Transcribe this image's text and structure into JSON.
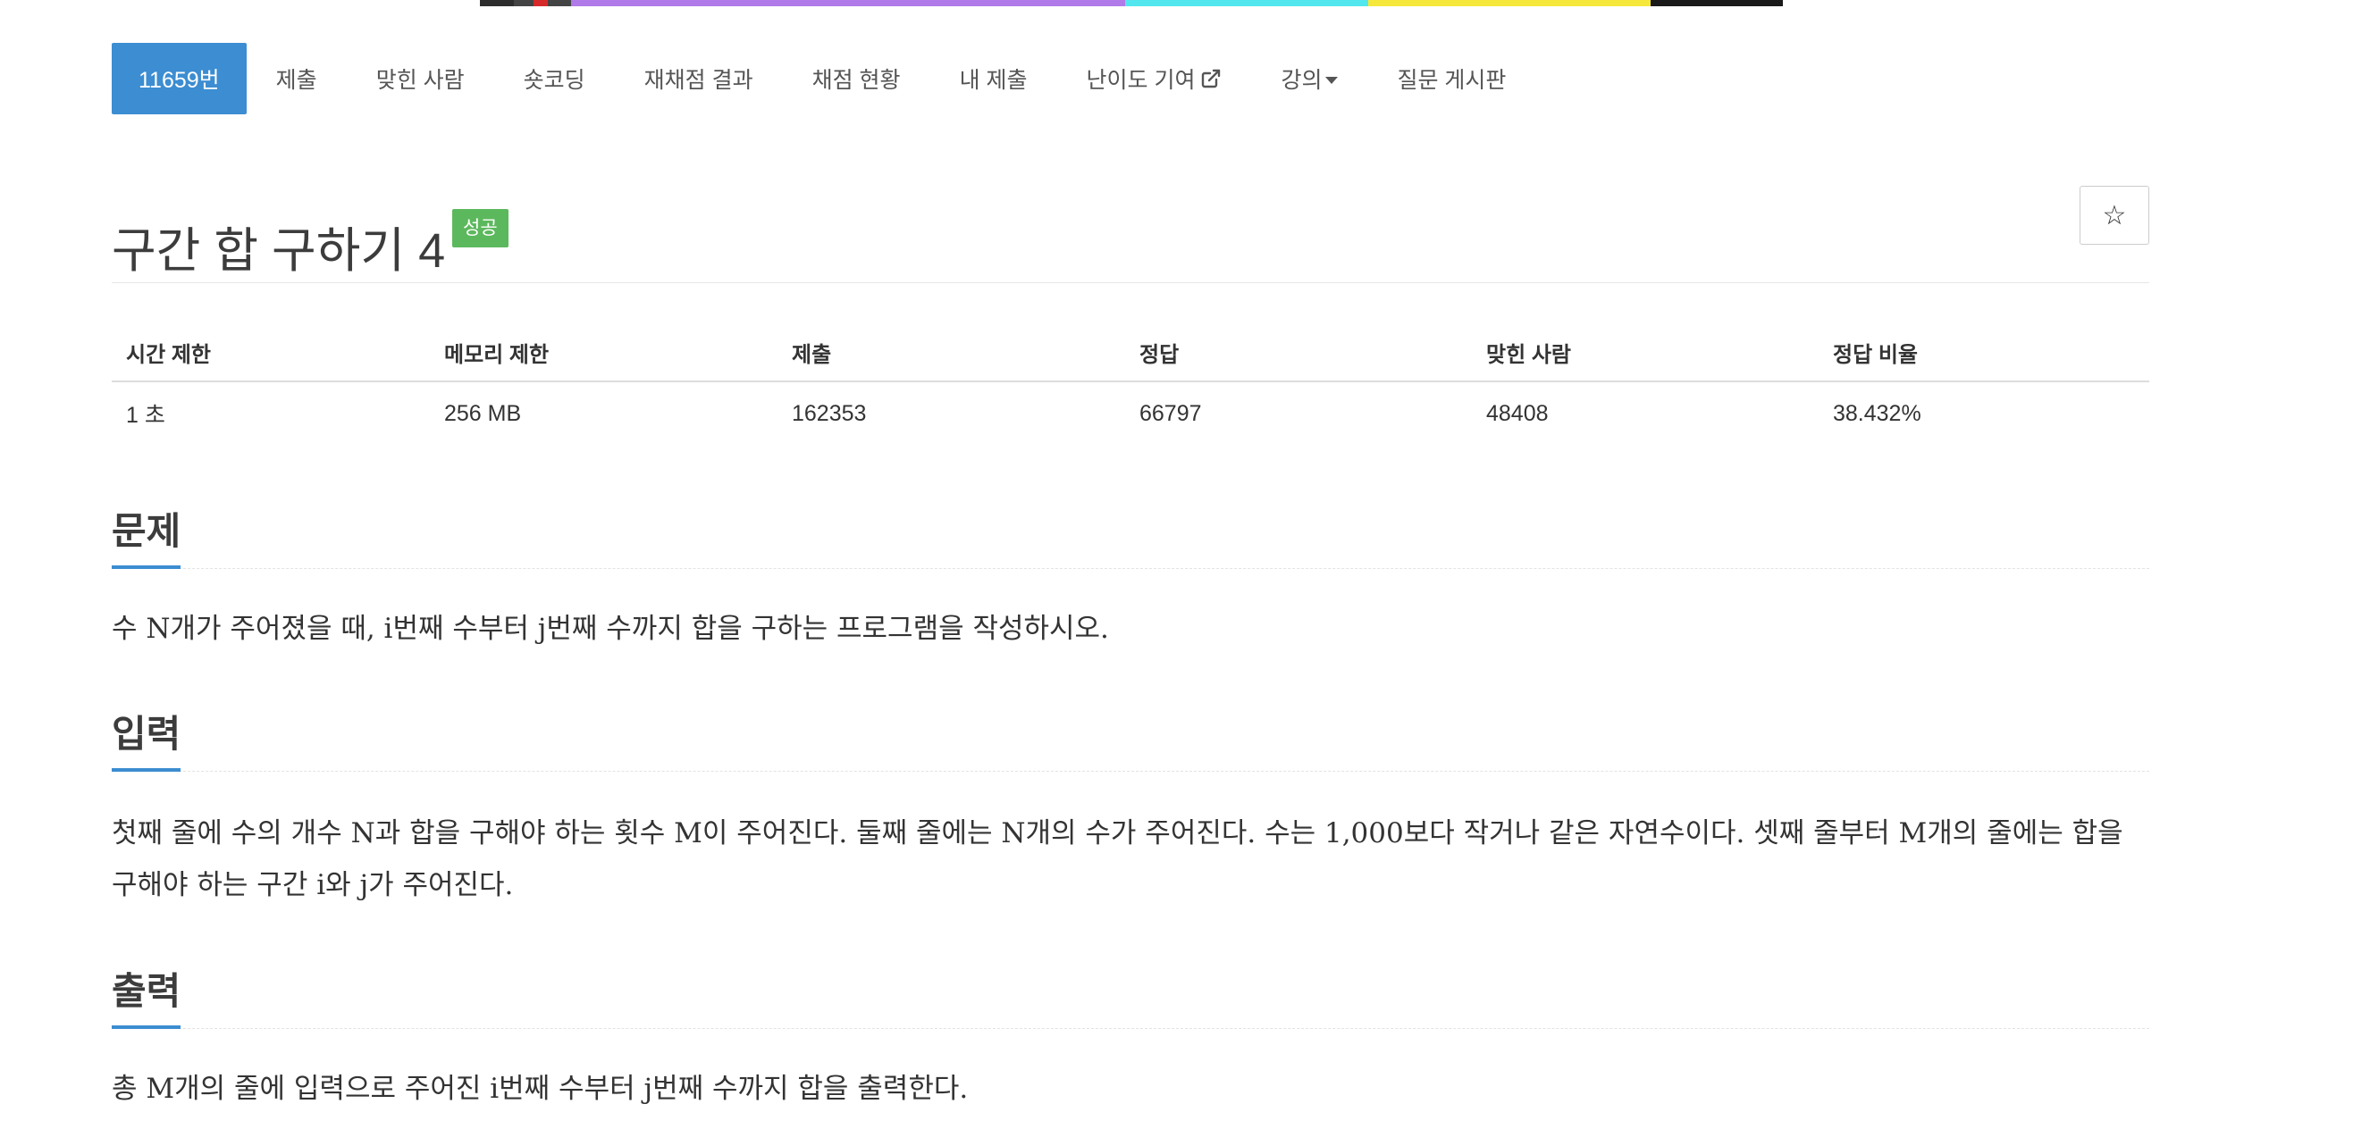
{
  "nav": {
    "items": [
      {
        "label": "11659번",
        "active": true
      },
      {
        "label": "제출"
      },
      {
        "label": "맞힌 사람"
      },
      {
        "label": "숏코딩"
      },
      {
        "label": "재채점 결과"
      },
      {
        "label": "채점 현황"
      },
      {
        "label": "내 제출"
      },
      {
        "label": "난이도 기여",
        "icon": "external-link-icon"
      },
      {
        "label": "강의",
        "icon": "caret-down-icon"
      },
      {
        "label": "질문 게시판"
      }
    ]
  },
  "problem": {
    "title": "구간 합 구하기 4",
    "badge": "성공",
    "star_icon": "☆"
  },
  "info_table": {
    "headers": [
      "시간 제한",
      "메모리 제한",
      "제출",
      "정답",
      "맞힌 사람",
      "정답 비율"
    ],
    "values": [
      "1 초",
      "256 MB",
      "162353",
      "66797",
      "48408",
      "38.432%"
    ]
  },
  "sections": {
    "problem": {
      "title": "문제",
      "body": "수 N개가 주어졌을 때, i번째 수부터 j번째 수까지 합을 구하는 프로그램을 작성하시오."
    },
    "input": {
      "title": "입력",
      "body": "첫째 줄에 수의 개수 N과 합을 구해야 하는 횟수 M이 주어진다. 둘째 줄에는 N개의 수가 주어진다. 수는 1,000보다 작거나 같은 자연수이다. 셋째 줄부터 M개의 줄에는 합을 구해야 하는 구간 i와 j가 주어진다."
    },
    "output": {
      "title": "출력",
      "body": "총 M개의 줄에 입력으로 주어진 i번째 수부터 j번째 수까지 합을 출력한다."
    }
  },
  "colors": {
    "accent": "#3c8dd1",
    "success": "#5cb85c"
  }
}
